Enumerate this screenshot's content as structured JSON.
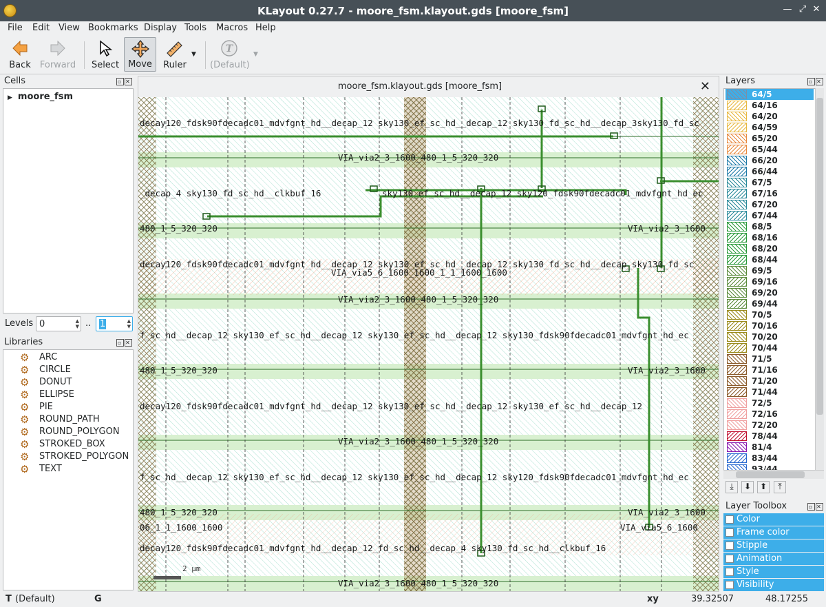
{
  "window": {
    "title": "KLayout 0.27.7 - moore_fsm.klayout.gds [moore_fsm]"
  },
  "menu": [
    "File",
    "Edit",
    "View",
    "Bookmarks",
    "Display",
    "Tools",
    "Macros",
    "Help"
  ],
  "toolbar": {
    "back": "Back",
    "forward": "Forward",
    "select": "Select",
    "move": "Move",
    "ruler": "Ruler",
    "default": "(Default)"
  },
  "cells": {
    "title": "Cells",
    "root": "moore_fsm"
  },
  "levels": {
    "label": "Levels",
    "min": "0",
    "sep": "..",
    "max": "1"
  },
  "libraries": {
    "title": "Libraries",
    "items": [
      "ARC",
      "CIRCLE",
      "DONUT",
      "ELLIPSE",
      "PIE",
      "ROUND_PATH",
      "ROUND_POLYGON",
      "STROKED_BOX",
      "STROKED_POLYGON",
      "TEXT"
    ]
  },
  "canvas": {
    "tab_title": "moore_fsm.klayout.gds [moore_fsm]",
    "scale_label": "2 µm",
    "labels": [
      "decay120_fdsk90fdecadc01_mdvfgnt_hd__decap_12 sky130_ef_sc_hd__decap_12 sky130_fd_sc_hd__decap_3sky130_fd_sc",
      "VIA_via2_3_1600_480_1_5_320_320",
      "_decap_4  sky130_fd_sc_hd__clkbuf_16",
      "sky130_ef_sc_hd__decap_12 sky120_fdsk90fdecadc01_mdvfgnt_hd_ec",
      "480_1_5_320_320",
      "VIA_via2_3_1600",
      "decay120_fdsk90fdecadc01_mdvfgnt_hd__decap_12 sky130_ef_sc_hd__decap_12 sky130_fd_sc_hd__decap_sky130_fd_sc",
      "VIA_via5_6_1600_1600_1_1_1600_1600",
      "VIA_via2_3_1600_480_1_5_320_320",
      "f_sc_hd__decap_12 sky130_ef_sc_hd__decap_12 sky130_ef_sc_hd__decap_12 sky130_fdsk90fdecadc01_mdvfgnt_hd_ec",
      "480_1_5_320_320",
      "VIA_via2_3_1600",
      "decay120_fdsk90fdecadc01_mdvfgnt_hd__decap_12 sky130_ef_sc_hd__decap_12 sky130_ef_sc_hd__decap_12",
      "VIA_via2_3_1600_480_1_5_320_320",
      "f_sc_hd__decap_12 sky130_ef_sc_hd__decap_12 sky130_ef_sc_hd__decap_12 sky120_fdsk90fdecadc01_mdvfgnt_hd_ec",
      "480_1_5_320_320",
      "VIA_via2_3_1600",
      "06_1_1_1600_1600",
      "VIA_via5_6_1600",
      "decay120_fdsk90fdecadc01_mdvfgnt_hd__decap_12_fd_sc_hd__decap_4 sky130_fd_sc_hd__clkbuf_16",
      "VIA_via2_3_1600_480_1_5_320_320"
    ]
  },
  "layers": {
    "title": "Layers",
    "items": [
      {
        "name": "64/5",
        "color": "#7a8fa8",
        "selected": true
      },
      {
        "name": "64/16",
        "color": "#e8b840"
      },
      {
        "name": "64/20",
        "color": "#e8b840"
      },
      {
        "name": "64/59",
        "color": "#e8b840"
      },
      {
        "name": "65/20",
        "color": "#e88a40"
      },
      {
        "name": "65/44",
        "color": "#e88a40"
      },
      {
        "name": "66/20",
        "color": "#1e7aa8"
      },
      {
        "name": "66/44",
        "color": "#1e7aa8"
      },
      {
        "name": "67/5",
        "color": "#2a8a9a"
      },
      {
        "name": "67/16",
        "color": "#2a8a9a"
      },
      {
        "name": "67/20",
        "color": "#2a8a9a"
      },
      {
        "name": "67/44",
        "color": "#2a8a9a"
      },
      {
        "name": "68/5",
        "color": "#2a9a3a"
      },
      {
        "name": "68/16",
        "color": "#2a9a3a"
      },
      {
        "name": "68/20",
        "color": "#2a9a3a"
      },
      {
        "name": "68/44",
        "color": "#2a9a3a"
      },
      {
        "name": "69/5",
        "color": "#5a8a3a"
      },
      {
        "name": "69/16",
        "color": "#5a8a3a"
      },
      {
        "name": "69/20",
        "color": "#5a8a3a"
      },
      {
        "name": "69/44",
        "color": "#5a8a3a"
      },
      {
        "name": "70/5",
        "color": "#9a8a1a"
      },
      {
        "name": "70/16",
        "color": "#9a8a1a"
      },
      {
        "name": "70/20",
        "color": "#9a8a1a"
      },
      {
        "name": "70/44",
        "color": "#9a8a1a"
      },
      {
        "name": "71/5",
        "color": "#8a5a2a"
      },
      {
        "name": "71/16",
        "color": "#8a5a2a"
      },
      {
        "name": "71/20",
        "color": "#8a5a2a"
      },
      {
        "name": "71/44",
        "color": "#8a5a2a"
      },
      {
        "name": "72/5",
        "color": "#f0a0a0"
      },
      {
        "name": "72/16",
        "color": "#f0a0a0"
      },
      {
        "name": "72/20",
        "color": "#f0a0a0"
      },
      {
        "name": "78/44",
        "color": "#c01030"
      },
      {
        "name": "81/4",
        "color": "#8a1ab0"
      },
      {
        "name": "83/44",
        "color": "#2a6ad0"
      },
      {
        "name": "93/44",
        "color": "#2a6ad0"
      }
    ]
  },
  "toolbox": {
    "title": "Layer Toolbox",
    "items": [
      "Color",
      "Frame color",
      "Stipple",
      "Animation",
      "Style",
      "Visibility"
    ]
  },
  "status": {
    "mode_t": "T",
    "mode_default": "(Default)",
    "g": "G",
    "xy_label": "xy",
    "x": "39.32507",
    "y": "48.17255"
  },
  "colors": {
    "accent": "#3daee9",
    "titlebar": "#475057"
  }
}
